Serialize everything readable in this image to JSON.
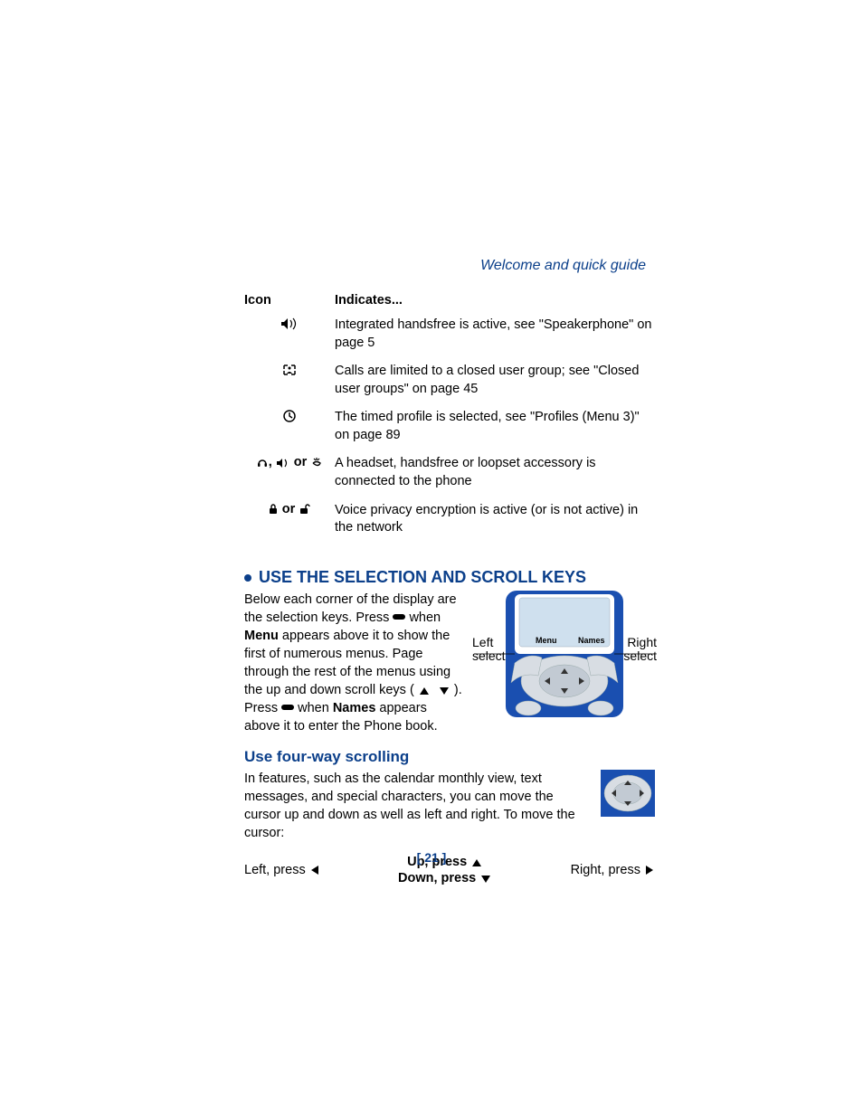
{
  "runningHead": "Welcome and quick guide",
  "table": {
    "header": {
      "c1": "Icon",
      "c2": "Indicates..."
    },
    "rows": [
      {
        "icon": "speaker-icon",
        "desc": "Integrated handsfree is active, see \"Speakerphone\" on page 5"
      },
      {
        "icon": "cug-icon",
        "desc": "Calls are limited to a closed user group; see \"Closed user groups\" on page 45"
      },
      {
        "icon": "clock-icon",
        "desc": "The timed profile is selected, see \"Profiles (Menu 3)\" on page 89"
      },
      {
        "icon": "accessory-icons",
        "or1": ", ",
        "or2": " or ",
        "desc": "A headset, handsfree or loopset accessory is connected to the phone"
      },
      {
        "icon": "privacy-icons",
        "or2": " or ",
        "desc": "Voice privacy encryption is active (or is not active) in the network"
      }
    ]
  },
  "section1": {
    "title": "USE THE SELECTION AND SCROLL KEYS",
    "para_a": "Below each corner of the display are the selection keys. Press ",
    "para_b": " when ",
    "menu": "Menu",
    "para_c": " appears above it to show the first of numerous menus. Page through the rest of the menus using the up and down scroll keys ( ",
    "para_d": " ). Press ",
    "para_e": " when ",
    "names": "Names",
    "para_f": " appears above it to enter the Phone book.",
    "labels": {
      "left1": "Left",
      "left2": "select",
      "right1": "Right",
      "right2": "select",
      "scrMenu": "Menu",
      "scrNames": "Names"
    }
  },
  "section2": {
    "title": "Use four-way scrolling",
    "para": "In features, such as the calendar monthly view, text messages, and special characters, you can move the cursor up and down as well as left and right. To move the cursor:"
  },
  "directions": {
    "left": "Left, press ",
    "up": "Up, press ",
    "down": "Down, press ",
    "right": "Right, press "
  },
  "pageNumber": "[ 21 ]"
}
